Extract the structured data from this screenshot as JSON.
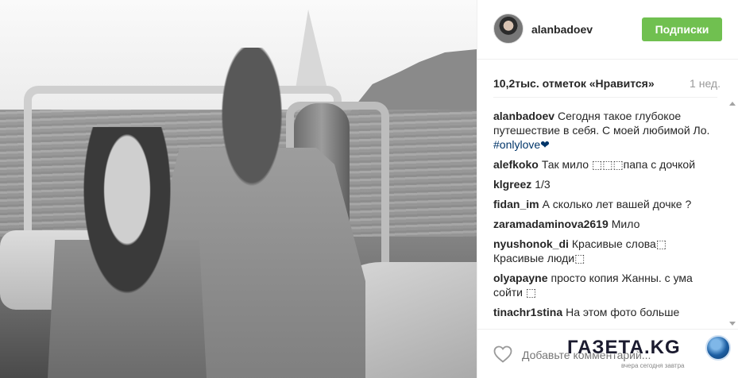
{
  "post": {
    "username": "alanbadoev",
    "follow_label": "Подписки",
    "likes_text": "10,2тыс. отметок «Нравится»",
    "age": "1 нед."
  },
  "comments": [
    {
      "user": "alanbadoev",
      "text": "Сегодня такое глубокое путешествие в себя. С моей любимой Ло.",
      "hashtag": "#onlylove❤"
    },
    {
      "user": "alefkoko",
      "text": "Так мило ⬚⬚⬚папа с дочкой"
    },
    {
      "user": "klgreez",
      "text": "1/3"
    },
    {
      "user": "fidan_im",
      "text": "А сколько лет вашей дочке ?"
    },
    {
      "user": "zaramadaminova2619",
      "text": "Мило"
    },
    {
      "user": "nyushonok_di",
      "text": "Красивые слова⬚ Красивые люди⬚"
    },
    {
      "user": "olyapayne",
      "text": "просто копия Жанны. с ума сойти ⬚"
    },
    {
      "user": "tinachr1stina",
      "text": "На этом фото больше"
    }
  ],
  "footer": {
    "add_comment_placeholder": "Добавьте комментарий...",
    "more_label": "···"
  },
  "watermark": {
    "text": "ГАЗЕТА.KG",
    "tagline": "вчера сегодня завтра"
  },
  "icons": {
    "like": "heart-outline-icon",
    "more": "ellipsis-icon"
  },
  "colors": {
    "follow_button": "#70c050",
    "hashtag": "#003569",
    "muted": "#999999"
  }
}
